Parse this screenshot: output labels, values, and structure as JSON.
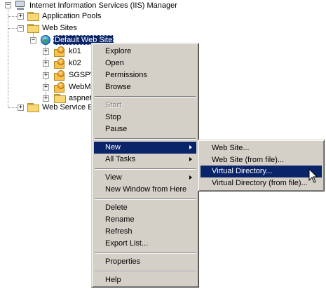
{
  "tree": {
    "root_label": "Internet Information Services (IIS) Manager",
    "app_pools_label": "Application Pools",
    "web_sites_label": "Web Sites",
    "default_site_label": "Default Web Site",
    "children": [
      "k01",
      "k02",
      "SGSPV",
      "WebM",
      "aspnet"
    ],
    "web_service_label": "Web Service E"
  },
  "context_menu": {
    "items": {
      "explore": "Explore",
      "open": "Open",
      "permissions": "Permissions",
      "browse": "Browse",
      "start": "Start",
      "stop": "Stop",
      "pause": "Pause",
      "new": "New",
      "all_tasks": "All Tasks",
      "view": "View",
      "new_window": "New Window from Here",
      "delete": "Delete",
      "rename": "Rename",
      "refresh": "Refresh",
      "export_list": "Export List...",
      "properties": "Properties",
      "help": "Help"
    },
    "highlighted": "New",
    "disabled": [
      "Start"
    ]
  },
  "submenu": {
    "items": {
      "web_site": "Web Site...",
      "web_site_from_file": "Web Site (from file)...",
      "virtual_directory": "Virtual Directory...",
      "virtual_directory_from_file": "Virtual Directory (from file)..."
    },
    "highlighted": "Virtual Directory..."
  },
  "colors": {
    "menu_bg": "#d4d0c8",
    "highlight": "#0a246a",
    "disabled_text": "#808080"
  }
}
